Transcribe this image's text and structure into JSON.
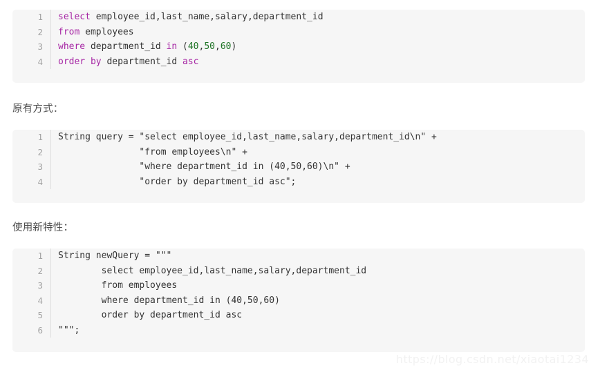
{
  "page": {
    "background_color": "#ffffff",
    "code_block_background": "#f6f6f6",
    "keyword_color": "#a626a4",
    "number_color": "#1d7324",
    "plain_text_color": "#333333",
    "gutter_color": "#a3a3a3"
  },
  "blocks": [
    {
      "id": "sql-query-block",
      "language": "sql",
      "lines": [
        {
          "number": "1",
          "tokens": [
            {
              "text": "select",
              "type": "keyword"
            },
            {
              "text": " employee_id,last_name,salary,department_id",
              "type": "plain"
            }
          ]
        },
        {
          "number": "2",
          "tokens": [
            {
              "text": "from",
              "type": "keyword"
            },
            {
              "text": " employees",
              "type": "plain"
            }
          ]
        },
        {
          "number": "3",
          "tokens": [
            {
              "text": "where",
              "type": "keyword"
            },
            {
              "text": " department_id ",
              "type": "plain"
            },
            {
              "text": "in",
              "type": "keyword"
            },
            {
              "text": " (",
              "type": "plain"
            },
            {
              "text": "40",
              "type": "number"
            },
            {
              "text": ",",
              "type": "plain"
            },
            {
              "text": "50",
              "type": "number"
            },
            {
              "text": ",",
              "type": "plain"
            },
            {
              "text": "60",
              "type": "number"
            },
            {
              "text": ")",
              "type": "plain"
            }
          ]
        },
        {
          "number": "4",
          "tokens": [
            {
              "text": "order",
              "type": "keyword"
            },
            {
              "text": " ",
              "type": "plain"
            },
            {
              "text": "by",
              "type": "keyword"
            },
            {
              "text": " department_id ",
              "type": "plain"
            },
            {
              "text": "asc",
              "type": "keyword"
            }
          ]
        }
      ]
    },
    {
      "id": "old-approach-block",
      "language": "java",
      "lines": [
        {
          "number": "1",
          "tokens": [
            {
              "text": "String query = \"select employee_id,last_name,salary,department_id\\n\" +",
              "type": "plain"
            }
          ]
        },
        {
          "number": "2",
          "tokens": [
            {
              "text": "               \"from employees\\n\" +",
              "type": "plain"
            }
          ]
        },
        {
          "number": "3",
          "tokens": [
            {
              "text": "               \"where department_id in (40,50,60)\\n\" +",
              "type": "plain"
            }
          ]
        },
        {
          "number": "4",
          "tokens": [
            {
              "text": "               \"order by department_id asc\";",
              "type": "plain"
            }
          ]
        }
      ]
    },
    {
      "id": "new-feature-block",
      "language": "java",
      "lines": [
        {
          "number": "1",
          "tokens": [
            {
              "text": "String newQuery = \"\"\"",
              "type": "plain"
            }
          ]
        },
        {
          "number": "2",
          "tokens": [
            {
              "text": "        select employee_id,last_name,salary,department_id",
              "type": "plain"
            }
          ]
        },
        {
          "number": "3",
          "tokens": [
            {
              "text": "        from employees",
              "type": "plain"
            }
          ]
        },
        {
          "number": "4",
          "tokens": [
            {
              "text": "        where department_id in (40,50,60)",
              "type": "plain"
            }
          ]
        },
        {
          "number": "5",
          "tokens": [
            {
              "text": "        order by department_id asc",
              "type": "plain"
            }
          ]
        },
        {
          "number": "6",
          "tokens": [
            {
              "text": "\"\"\";",
              "type": "plain"
            }
          ]
        }
      ]
    }
  ],
  "headings": {
    "old_approach": "原有方式：",
    "new_feature": "使用新特性："
  },
  "watermark": {
    "text": "https://blog.csdn.net/xiaotai1234"
  }
}
